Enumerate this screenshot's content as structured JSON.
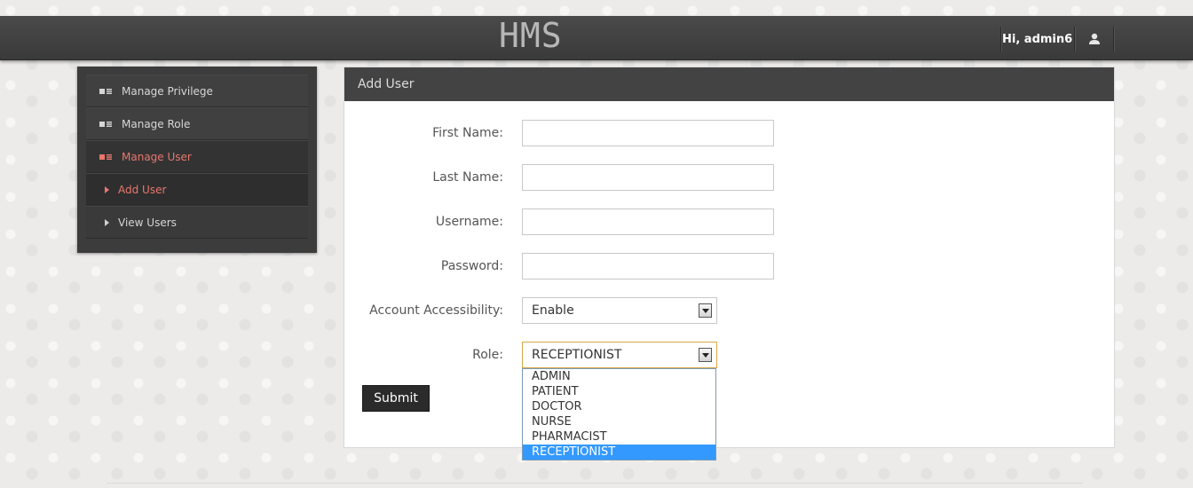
{
  "header": {
    "brand": "HMS",
    "greeting": "Hi, admin6",
    "user_icon": "user-icon"
  },
  "sidebar": {
    "items": [
      {
        "label": "Manage Privilege",
        "icon": "list-icon"
      },
      {
        "label": "Manage Role",
        "icon": "list-icon"
      },
      {
        "label": "Manage User",
        "icon": "list-icon",
        "active": true
      },
      {
        "label": "Add User",
        "icon": "caret-right-icon",
        "active": true
      },
      {
        "label": "View Users",
        "icon": "caret-right-icon"
      }
    ]
  },
  "panel": {
    "title": "Add User",
    "fields": {
      "first_name": {
        "label": "First Name:",
        "value": ""
      },
      "last_name": {
        "label": "Last Name:",
        "value": ""
      },
      "username": {
        "label": "Username:",
        "value": ""
      },
      "password": {
        "label": "Password:",
        "value": ""
      },
      "accessibility": {
        "label": "Account Accessibility:",
        "value": "Enable"
      },
      "role": {
        "label": "Role:",
        "value": "RECEPTIONIST",
        "options": [
          "ADMIN",
          "PATIENT",
          "DOCTOR",
          "NURSE",
          "PHARMACIST",
          "RECEPTIONIST"
        ]
      }
    },
    "submit_label": "Submit"
  },
  "colors": {
    "accent": "#e8776d",
    "topbar": "#434343",
    "selected_option": "#3399ff"
  }
}
